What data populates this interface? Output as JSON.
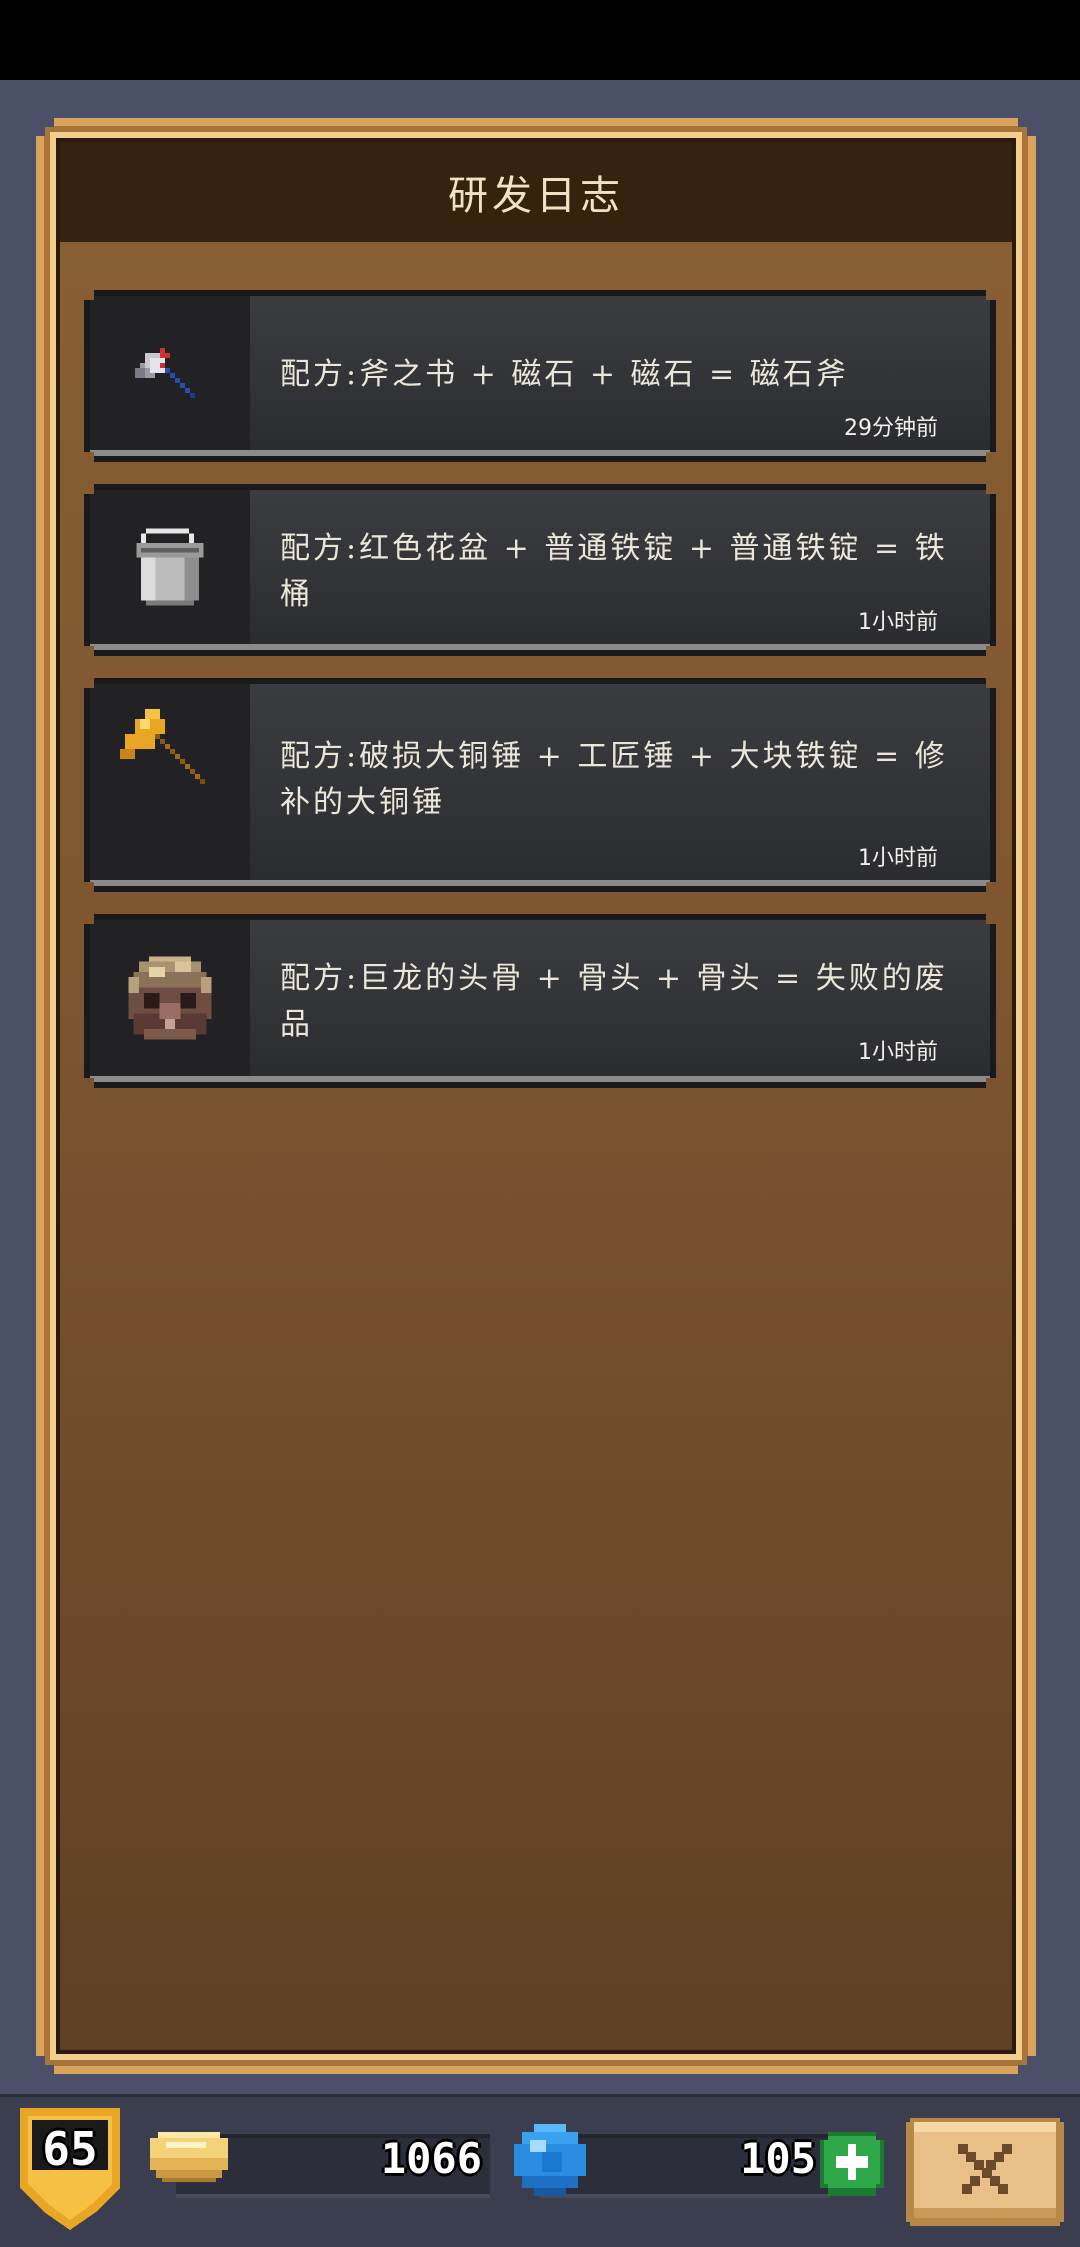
{
  "panel": {
    "title": "研发日志"
  },
  "recipes": [
    {
      "icon": "magnet-axe-icon",
      "text": "配方:斧之书 + 磁石 + 磁石 = 磁石斧",
      "time": "29分钟前"
    },
    {
      "icon": "iron-bucket-icon",
      "text": "配方:红色花盆 + 普通铁锭 + 普通铁锭 = 铁桶",
      "time": "1小时前"
    },
    {
      "icon": "bronze-hammer-icon",
      "text": "配方:破损大铜锤 + 工匠锤 + 大块铁锭 = 修补的大铜锤",
      "time": "1小时前"
    },
    {
      "icon": "dragon-skull-icon",
      "text": "配方:巨龙的头骨 + 骨头 + 骨头 = 失败的废品",
      "time": "1小时前"
    }
  ],
  "bottom_bar": {
    "level": "65",
    "gold": "1066",
    "gems": "105",
    "add_icon": "plus-icon",
    "close_icon": "close-x-icon"
  },
  "colors": {
    "panel_header": "#35220f",
    "panel_border": "#d9a35c",
    "card_bg": "#323337",
    "add_button": "#2fa84a",
    "gem": "#3aa0f0",
    "gold": "#f3d27a"
  }
}
